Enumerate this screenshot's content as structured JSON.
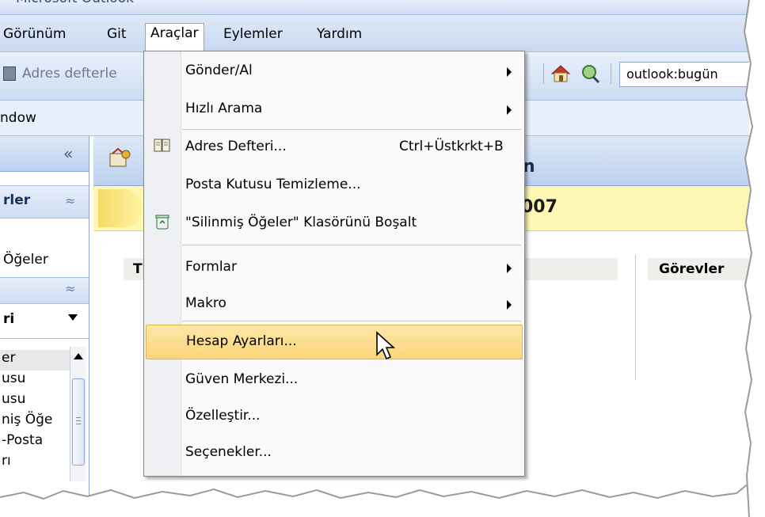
{
  "window": {
    "title_partial": "Microsoft Outlook"
  },
  "menubar": {
    "items": [
      "Görünüm",
      "Git",
      "Araçlar",
      "Eylemler",
      "Yardım"
    ],
    "active": "Araçlar"
  },
  "toolbar": {
    "address_book_label": "Adres defterle",
    "url_value": "outlook:bugün",
    "home_icon": "home-icon",
    "search_icon": "search-icon"
  },
  "window_band": {
    "label": "ndow"
  },
  "nav": {
    "collapse_glyph": "«",
    "section1_label": "rler",
    "section1_chevron": "≈",
    "item_ogeler": "Öğeler",
    "section2_chevron": "≈",
    "subheader_label": "ri",
    "folders": [
      "er",
      "usu",
      "usu",
      "niş Öğe",
      "-Posta",
      "rı"
    ]
  },
  "main": {
    "title_partial": "n",
    "date_partial": "007",
    "col1_header_partial": "T",
    "col2_header": "Görevler"
  },
  "dropdown": {
    "items": [
      {
        "label": "Gönder/Al",
        "submenu": true
      },
      {
        "label": "Hızlı Arama",
        "submenu": true
      },
      {
        "label": "Adres Defteri...",
        "shortcut": "Ctrl+Üstkrkt+B",
        "icon": "address-book-icon"
      },
      {
        "label": "Posta Kutusu Temizleme..."
      },
      {
        "label": "\"Silinmiş Öğeler\" Klasörünü Boşalt",
        "icon": "recycle-bin-icon"
      },
      {
        "label": "Formlar",
        "submenu": true
      },
      {
        "label": "Makro",
        "submenu": true
      },
      {
        "label": "Hesap Ayarları...",
        "highlighted": true
      },
      {
        "label": "Güven Merkezi..."
      },
      {
        "label": "Özelleştir..."
      },
      {
        "label": "Seçenekler..."
      }
    ]
  },
  "colors": {
    "menubar_bg": "#c9d9f1",
    "highlight": "#fbd57a",
    "yellow_band": "#fff8b5",
    "title_blue": "#16305e"
  }
}
